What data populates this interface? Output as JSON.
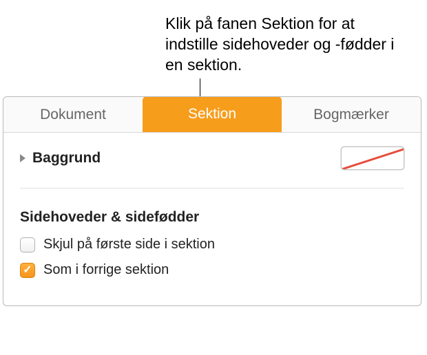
{
  "callout": "Klik på fanen Sektion for at indstille sidehoveder og -fødder i en sektion.",
  "tabs": {
    "document": "Dokument",
    "section": "Sektion",
    "bookmarks": "Bogmærker",
    "active": "section"
  },
  "background": {
    "label": "Baggrund",
    "swatch": "none"
  },
  "headersFooters": {
    "title": "Sidehoveder & sidefødder",
    "hideFirst": {
      "label": "Skjul på første side i sektion",
      "checked": false
    },
    "sameAsPrev": {
      "label": "Som i forrige sektion",
      "checked": true
    }
  }
}
